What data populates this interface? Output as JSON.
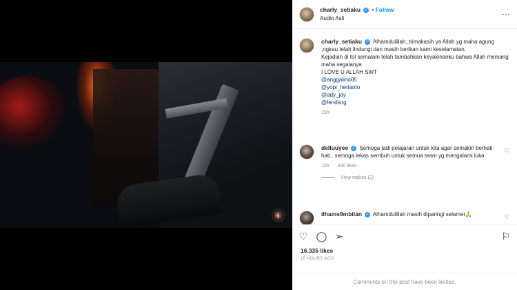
{
  "post": {
    "username": "charly_setiaku",
    "follow_label": "Follow",
    "audio": "Audio Asli",
    "separator": "•"
  },
  "caption": {
    "username": "charly_setiaku",
    "lines": [
      "Alhamdulillah..trimakasih ya Allah yg maha agung ,ngkau telah lindungi dan masih berikan kami keselamatan.",
      "Kejadian di tol semalam telah tambahkan keyakinanku bahwa Allah memang maha segalanya",
      "I LOVE U ALLAH SWT"
    ],
    "mentions": [
      "@anggalino05",
      "@yopi_herianto",
      "@ady_joy",
      "@fendisrg"
    ],
    "time": "15h"
  },
  "comments": [
    {
      "username": "delluuyee",
      "text": "Semoga jadi pelajaran untuk kita agar semakin berhati hati.. semoga lekas sembuh untuk semua team yg mengalami luka",
      "time": "15h",
      "likes": "330 likes",
      "view_replies": "View replies (2)"
    },
    {
      "username": "ilhams9mbilan",
      "text": "Alhamdulillah masih diparingi selamet🙏"
    }
  ],
  "actions": {
    "like_icon": "heart-icon",
    "comment_icon": "comment-icon",
    "share_icon": "send-icon",
    "save_icon": "bookmark-icon"
  },
  "stats": {
    "likes": "16.335 likes",
    "posted": "15 HOURS AGO"
  },
  "footer": {
    "limited": "Comments on this post have been limited."
  },
  "colors": {
    "accent": "#0095f6",
    "verified": "#3897f0",
    "muted": "#8e8e8e"
  }
}
